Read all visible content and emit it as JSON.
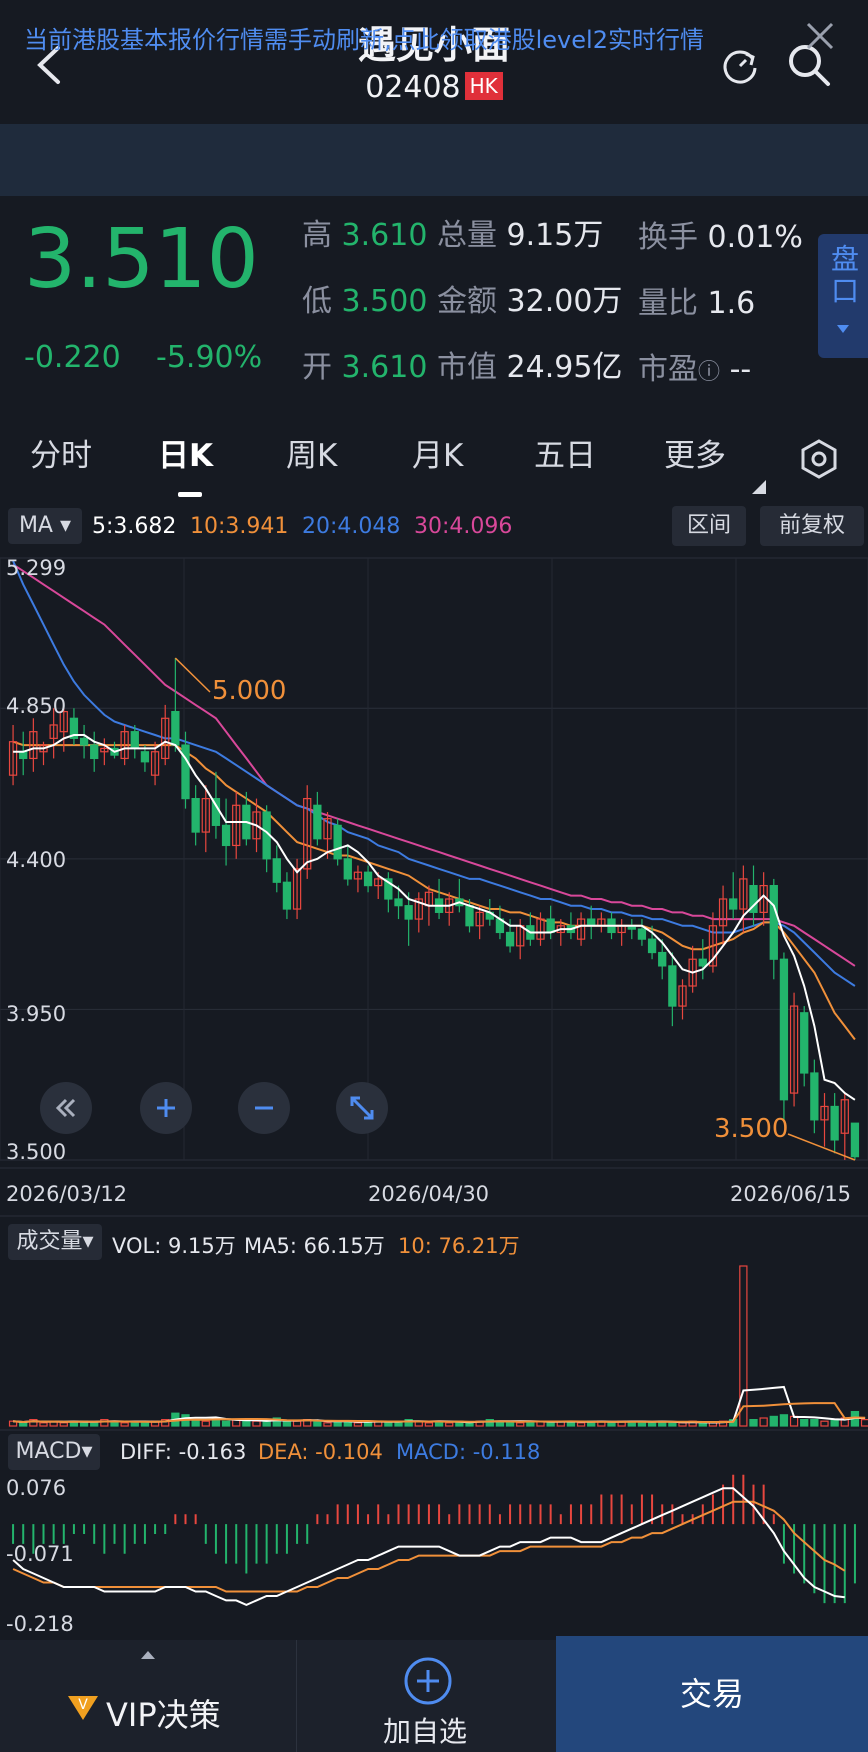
{
  "header": {
    "title": "遇见小面",
    "code": "02408",
    "market_badge": "HK",
    "icons": [
      "back-arrow-icon",
      "refresh-icon",
      "search-icon"
    ]
  },
  "notice": {
    "text": "当前港股基本报价行情需手动刷新,点此领取港股level2实时行情",
    "close_icon": "close-icon"
  },
  "quote": {
    "price": "3.510",
    "change": "-0.220",
    "change_pct": "-5.90%",
    "high_label": "高",
    "high": "3.610",
    "low_label": "低",
    "low": "3.500",
    "open_label": "开",
    "open": "3.610",
    "volume_label": "总量",
    "volume": "9.15万",
    "turnover_label": "金额",
    "turnover": "32.00万",
    "mktcap_label": "市值",
    "mktcap": "24.95亿",
    "turnover_rate_label": "换手",
    "turnover_rate": "0.01%",
    "vol_ratio_label": "量比",
    "vol_ratio": "1.6",
    "pe_label": "市盈",
    "pe": "--",
    "panel_label": "盘口"
  },
  "tabs": [
    "分时",
    "日K",
    "周K",
    "月K",
    "五日",
    "更多"
  ],
  "active_tab": "日K",
  "ma_legend": {
    "toggle": "MA",
    "ma5": "5:3.682",
    "ma10": "10:3.941",
    "ma20": "20:4.048",
    "ma30": "30:4.096",
    "range_btn": "区间",
    "adjust_btn": "前复权"
  },
  "colors": {
    "up": "#e8473f",
    "down": "#23b46c",
    "ma5": "#ffffff",
    "ma10": "#f0903a",
    "ma20": "#3d7be0",
    "ma30": "#d8489a",
    "accent": "#4f8cf0"
  },
  "chart_data": {
    "type": "candlestick",
    "y_ticks": [
      "5.299",
      "4.850",
      "4.400",
      "3.950",
      "3.500"
    ],
    "ylim": [
      3.5,
      5.299
    ],
    "x_ticks": [
      "2026/03/12",
      "2026/04/30",
      "2026/06/15"
    ],
    "annotations": {
      "max": "5.000",
      "min": "3.500"
    },
    "candles": [
      {
        "o": 4.65,
        "h": 4.8,
        "l": 4.62,
        "c": 4.75
      },
      {
        "o": 4.72,
        "h": 4.78,
        "l": 4.65,
        "c": 4.7
      },
      {
        "o": 4.7,
        "h": 4.82,
        "l": 4.66,
        "c": 4.78
      },
      {
        "o": 4.72,
        "h": 4.75,
        "l": 4.68,
        "c": 4.74
      },
      {
        "o": 4.76,
        "h": 4.85,
        "l": 4.7,
        "c": 4.8
      },
      {
        "o": 4.78,
        "h": 4.86,
        "l": 4.72,
        "c": 4.84
      },
      {
        "o": 4.82,
        "h": 4.85,
        "l": 4.74,
        "c": 4.76
      },
      {
        "o": 4.76,
        "h": 4.8,
        "l": 4.7,
        "c": 4.74
      },
      {
        "o": 4.74,
        "h": 4.78,
        "l": 4.66,
        "c": 4.7
      },
      {
        "o": 4.72,
        "h": 4.76,
        "l": 4.68,
        "c": 4.73
      },
      {
        "o": 4.73,
        "h": 4.75,
        "l": 4.7,
        "c": 4.71
      },
      {
        "o": 4.7,
        "h": 4.8,
        "l": 4.68,
        "c": 4.78
      },
      {
        "o": 4.78,
        "h": 4.8,
        "l": 4.7,
        "c": 4.73
      },
      {
        "o": 4.72,
        "h": 4.74,
        "l": 4.66,
        "c": 4.69
      },
      {
        "o": 4.65,
        "h": 4.75,
        "l": 4.62,
        "c": 4.72
      },
      {
        "o": 4.7,
        "h": 4.86,
        "l": 4.68,
        "c": 4.82
      },
      {
        "o": 4.84,
        "h": 5.0,
        "l": 4.72,
        "c": 4.74
      },
      {
        "o": 4.74,
        "h": 4.78,
        "l": 4.55,
        "c": 4.58
      },
      {
        "o": 4.58,
        "h": 4.62,
        "l": 4.44,
        "c": 4.48
      },
      {
        "o": 4.48,
        "h": 4.62,
        "l": 4.42,
        "c": 4.58
      },
      {
        "o": 4.58,
        "h": 4.66,
        "l": 4.46,
        "c": 4.5
      },
      {
        "o": 4.5,
        "h": 4.58,
        "l": 4.38,
        "c": 4.44
      },
      {
        "o": 4.44,
        "h": 4.6,
        "l": 4.4,
        "c": 4.56
      },
      {
        "o": 4.56,
        "h": 4.6,
        "l": 4.44,
        "c": 4.46
      },
      {
        "o": 4.46,
        "h": 4.58,
        "l": 4.42,
        "c": 4.54
      },
      {
        "o": 4.54,
        "h": 4.56,
        "l": 4.36,
        "c": 4.4
      },
      {
        "o": 4.4,
        "h": 4.44,
        "l": 4.3,
        "c": 4.33
      },
      {
        "o": 4.33,
        "h": 4.36,
        "l": 4.22,
        "c": 4.25
      },
      {
        "o": 4.25,
        "h": 4.4,
        "l": 4.22,
        "c": 4.37
      },
      {
        "o": 4.37,
        "h": 4.62,
        "l": 4.34,
        "c": 4.58
      },
      {
        "o": 4.56,
        "h": 4.6,
        "l": 4.44,
        "c": 4.46
      },
      {
        "o": 4.46,
        "h": 4.54,
        "l": 4.4,
        "c": 4.52
      },
      {
        "o": 4.5,
        "h": 4.52,
        "l": 4.38,
        "c": 4.4
      },
      {
        "o": 4.4,
        "h": 4.44,
        "l": 4.32,
        "c": 4.34
      },
      {
        "o": 4.34,
        "h": 4.38,
        "l": 4.3,
        "c": 4.36
      },
      {
        "o": 4.36,
        "h": 4.38,
        "l": 4.3,
        "c": 4.32
      },
      {
        "o": 4.32,
        "h": 4.36,
        "l": 4.28,
        "c": 4.34
      },
      {
        "o": 4.34,
        "h": 4.36,
        "l": 4.24,
        "c": 4.28
      },
      {
        "o": 4.28,
        "h": 4.32,
        "l": 4.22,
        "c": 4.26
      },
      {
        "o": 4.26,
        "h": 4.3,
        "l": 4.14,
        "c": 4.22
      },
      {
        "o": 4.22,
        "h": 4.3,
        "l": 4.18,
        "c": 4.28
      },
      {
        "o": 4.26,
        "h": 4.32,
        "l": 4.2,
        "c": 4.3
      },
      {
        "o": 4.28,
        "h": 4.34,
        "l": 4.22,
        "c": 4.24
      },
      {
        "o": 4.24,
        "h": 4.3,
        "l": 4.2,
        "c": 4.28
      },
      {
        "o": 4.28,
        "h": 4.34,
        "l": 4.24,
        "c": 4.26
      },
      {
        "o": 4.26,
        "h": 4.28,
        "l": 4.18,
        "c": 4.2
      },
      {
        "o": 4.2,
        "h": 4.26,
        "l": 4.16,
        "c": 4.24
      },
      {
        "o": 4.24,
        "h": 4.28,
        "l": 4.2,
        "c": 4.22
      },
      {
        "o": 4.22,
        "h": 4.26,
        "l": 4.16,
        "c": 4.18
      },
      {
        "o": 4.18,
        "h": 4.22,
        "l": 4.12,
        "c": 4.14
      },
      {
        "o": 4.14,
        "h": 4.22,
        "l": 4.1,
        "c": 4.2
      },
      {
        "o": 4.2,
        "h": 4.24,
        "l": 4.14,
        "c": 4.16
      },
      {
        "o": 4.16,
        "h": 4.24,
        "l": 4.14,
        "c": 4.22
      },
      {
        "o": 4.22,
        "h": 4.26,
        "l": 4.16,
        "c": 4.18
      },
      {
        "o": 4.18,
        "h": 4.22,
        "l": 4.14,
        "c": 4.2
      },
      {
        "o": 4.2,
        "h": 4.24,
        "l": 4.16,
        "c": 4.18
      },
      {
        "o": 4.16,
        "h": 4.24,
        "l": 4.14,
        "c": 4.22
      },
      {
        "o": 4.22,
        "h": 4.26,
        "l": 4.16,
        "c": 4.2
      },
      {
        "o": 4.2,
        "h": 4.24,
        "l": 4.18,
        "c": 4.22
      },
      {
        "o": 4.22,
        "h": 4.24,
        "l": 4.16,
        "c": 4.18
      },
      {
        "o": 4.18,
        "h": 4.22,
        "l": 4.14,
        "c": 4.2
      },
      {
        "o": 4.2,
        "h": 4.22,
        "l": 4.16,
        "c": 4.19
      },
      {
        "o": 4.19,
        "h": 4.22,
        "l": 4.14,
        "c": 4.16
      },
      {
        "o": 4.16,
        "h": 4.2,
        "l": 4.1,
        "c": 4.12
      },
      {
        "o": 4.12,
        "h": 4.16,
        "l": 4.04,
        "c": 4.08
      },
      {
        "o": 4.08,
        "h": 4.12,
        "l": 3.9,
        "c": 3.96
      },
      {
        "o": 3.96,
        "h": 4.04,
        "l": 3.92,
        "c": 4.02
      },
      {
        "o": 4.02,
        "h": 4.14,
        "l": 4.0,
        "c": 4.1
      },
      {
        "o": 4.1,
        "h": 4.16,
        "l": 4.04,
        "c": 4.08
      },
      {
        "o": 4.08,
        "h": 4.24,
        "l": 4.06,
        "c": 4.2
      },
      {
        "o": 4.2,
        "h": 4.32,
        "l": 4.14,
        "c": 4.28
      },
      {
        "o": 4.28,
        "h": 4.36,
        "l": 4.22,
        "c": 4.25
      },
      {
        "o": 4.25,
        "h": 4.38,
        "l": 4.18,
        "c": 4.34
      },
      {
        "o": 4.32,
        "h": 4.38,
        "l": 4.2,
        "c": 4.24
      },
      {
        "o": 4.24,
        "h": 4.36,
        "l": 4.2,
        "c": 4.32
      },
      {
        "o": 4.32,
        "h": 4.34,
        "l": 4.04,
        "c": 4.1
      },
      {
        "o": 4.1,
        "h": 4.12,
        "l": 3.62,
        "c": 3.68
      },
      {
        "o": 3.7,
        "h": 4.0,
        "l": 3.66,
        "c": 3.96
      },
      {
        "o": 3.94,
        "h": 3.96,
        "l": 3.72,
        "c": 3.76
      },
      {
        "o": 3.76,
        "h": 3.8,
        "l": 3.58,
        "c": 3.62
      },
      {
        "o": 3.62,
        "h": 3.7,
        "l": 3.54,
        "c": 3.66
      },
      {
        "o": 3.66,
        "h": 3.7,
        "l": 3.52,
        "c": 3.56
      },
      {
        "o": 3.58,
        "h": 3.7,
        "l": 3.5,
        "c": 3.68
      },
      {
        "o": 3.61,
        "h": 3.61,
        "l": 3.5,
        "c": 3.51
      }
    ],
    "ma5_line": [
      4.72,
      4.72,
      4.73,
      4.73,
      4.74,
      4.76,
      4.77,
      4.77,
      4.75,
      4.74,
      4.72,
      4.73,
      4.73,
      4.73,
      4.73,
      4.75,
      4.74,
      4.7,
      4.65,
      4.61,
      4.56,
      4.51,
      4.51,
      4.51,
      4.5,
      4.48,
      4.45,
      4.4,
      4.36,
      4.39,
      4.4,
      4.42,
      4.43,
      4.44,
      4.42,
      4.39,
      4.35,
      4.33,
      4.31,
      4.28,
      4.27,
      4.26,
      4.26,
      4.26,
      4.27,
      4.26,
      4.25,
      4.24,
      4.22,
      4.2,
      4.2,
      4.18,
      4.18,
      4.18,
      4.19,
      4.19,
      4.2,
      4.2,
      4.2,
      4.2,
      4.2,
      4.2,
      4.2,
      4.18,
      4.15,
      4.11,
      4.07,
      4.06,
      4.07,
      4.1,
      4.14,
      4.18,
      4.23,
      4.26,
      4.29,
      4.26,
      4.17,
      4.11,
      4.02,
      3.9,
      3.74,
      3.73,
      3.7,
      3.68
    ],
    "ma10_line": [
      4.75,
      4.74,
      4.74,
      4.74,
      4.74,
      4.74,
      4.74,
      4.74,
      4.74,
      4.74,
      4.74,
      4.74,
      4.74,
      4.74,
      4.74,
      4.74,
      4.74,
      4.72,
      4.7,
      4.67,
      4.65,
      4.62,
      4.6,
      4.58,
      4.56,
      4.54,
      4.51,
      4.48,
      4.45,
      4.44,
      4.43,
      4.42,
      4.41,
      4.41,
      4.4,
      4.39,
      4.38,
      4.37,
      4.36,
      4.35,
      4.33,
      4.31,
      4.3,
      4.29,
      4.28,
      4.27,
      4.26,
      4.25,
      4.25,
      4.24,
      4.24,
      4.23,
      4.22,
      4.21,
      4.21,
      4.2,
      4.2,
      4.2,
      4.2,
      4.2,
      4.2,
      4.2,
      4.2,
      4.19,
      4.18,
      4.16,
      4.14,
      4.13,
      4.13,
      4.14,
      4.15,
      4.16,
      4.18,
      4.19,
      4.21,
      4.21,
      4.18,
      4.14,
      4.1,
      4.06,
      4.0,
      3.94,
      3.9,
      3.86
    ],
    "ma20_line": [
      5.29,
      5.22,
      5.16,
      5.1,
      5.04,
      4.98,
      4.93,
      4.89,
      4.86,
      4.83,
      4.81,
      4.8,
      4.79,
      4.78,
      4.77,
      4.76,
      4.76,
      4.75,
      4.74,
      4.73,
      4.72,
      4.7,
      4.68,
      4.66,
      4.64,
      4.62,
      4.6,
      4.58,
      4.56,
      4.55,
      4.53,
      4.51,
      4.5,
      4.48,
      4.47,
      4.46,
      4.44,
      4.43,
      4.42,
      4.4,
      4.39,
      4.38,
      4.37,
      4.36,
      4.35,
      4.34,
      4.34,
      4.33,
      4.32,
      4.31,
      4.3,
      4.29,
      4.28,
      4.28,
      4.27,
      4.26,
      4.26,
      4.25,
      4.25,
      4.24,
      4.24,
      4.23,
      4.23,
      4.22,
      4.22,
      4.21,
      4.2,
      4.2,
      4.19,
      4.18,
      4.18,
      4.18,
      4.19,
      4.2,
      4.21,
      4.21,
      4.2,
      4.18,
      4.15,
      4.12,
      4.09,
      4.06,
      4.04,
      4.02
    ],
    "ma30_line": [
      5.28,
      5.26,
      5.24,
      5.22,
      5.2,
      5.18,
      5.16,
      5.14,
      5.12,
      5.1,
      5.07,
      5.04,
      5.01,
      4.98,
      4.95,
      4.92,
      4.9,
      4.88,
      4.86,
      4.84,
      4.82,
      4.78,
      4.74,
      4.7,
      4.66,
      4.62,
      4.6,
      4.58,
      4.56,
      4.55,
      4.54,
      4.53,
      4.52,
      4.51,
      4.5,
      4.49,
      4.48,
      4.47,
      4.46,
      4.45,
      4.44,
      4.43,
      4.42,
      4.41,
      4.4,
      4.39,
      4.38,
      4.37,
      4.36,
      4.35,
      4.34,
      4.33,
      4.32,
      4.31,
      4.3,
      4.29,
      4.29,
      4.28,
      4.28,
      4.27,
      4.27,
      4.26,
      4.26,
      4.25,
      4.25,
      4.24,
      4.24,
      4.23,
      4.23,
      4.22,
      4.22,
      4.22,
      4.22,
      4.22,
      4.22,
      4.22,
      4.21,
      4.2,
      4.18,
      4.16,
      4.14,
      4.12,
      4.1,
      4.08
    ],
    "volume": {
      "toggle": "成交量",
      "vol": "VOL: 9.15万",
      "ma5": "MA5: 66.15万",
      "ma10": "10: 76.21万",
      "bars": [
        3,
        2,
        4,
        2,
        3,
        2,
        3,
        3,
        2,
        4,
        3,
        2,
        3,
        2,
        3,
        4,
        8,
        7,
        4,
        3,
        5,
        3,
        4,
        3,
        3,
        3,
        5,
        3,
        3,
        4,
        3,
        2,
        3,
        3,
        2,
        3,
        3,
        2,
        3,
        4,
        3,
        2,
        3,
        2,
        3,
        2,
        3,
        4,
        3,
        3,
        2,
        3,
        3,
        2,
        3,
        3,
        2,
        3,
        3,
        2,
        3,
        3,
        3,
        2,
        3,
        2,
        2,
        3,
        2,
        2,
        3,
        4,
        100,
        4,
        5,
        6,
        7,
        6,
        4,
        4,
        3,
        4,
        5,
        9,
        4
      ]
    },
    "macd": {
      "toggle": "MACD",
      "diff": "DIFF: -0.163",
      "dea": "DEA: -0.104",
      "macd": "MACD: -0.118",
      "y_ticks": [
        "0.076",
        "-0.071",
        "-0.218"
      ],
      "hist": [
        -0.02,
        -0.02,
        -0.03,
        -0.02,
        -0.02,
        -0.02,
        -0.01,
        -0.01,
        -0.02,
        -0.03,
        -0.02,
        -0.03,
        -0.02,
        -0.02,
        -0.01,
        -0.01,
        0.01,
        0.01,
        0.01,
        -0.02,
        -0.03,
        -0.04,
        -0.04,
        -0.05,
        -0.04,
        -0.04,
        -0.03,
        -0.03,
        -0.02,
        -0.02,
        0.01,
        0.01,
        0.02,
        0.02,
        0.02,
        0.01,
        0.02,
        0.01,
        0.02,
        0.02,
        0.02,
        0.02,
        0.02,
        0.01,
        0.02,
        0.02,
        0.02,
        0.02,
        0.01,
        0.02,
        0.02,
        0.02,
        0.02,
        0.02,
        0.01,
        0.02,
        0.02,
        0.02,
        0.03,
        0.03,
        0.03,
        0.02,
        0.03,
        0.03,
        0.02,
        0.02,
        0.01,
        0.01,
        0.02,
        0.03,
        0.04,
        0.05,
        0.05,
        0.04,
        0.04,
        0.01,
        -0.04,
        -0.05,
        -0.06,
        -0.07,
        -0.08,
        -0.08,
        -0.08,
        -0.06
      ],
      "diff_line": [
        -0.08,
        -0.1,
        -0.11,
        -0.12,
        -0.13,
        -0.14,
        -0.14,
        -0.14,
        -0.14,
        -0.15,
        -0.15,
        -0.15,
        -0.15,
        -0.15,
        -0.15,
        -0.14,
        -0.14,
        -0.14,
        -0.15,
        -0.15,
        -0.16,
        -0.17,
        -0.17,
        -0.18,
        -0.17,
        -0.16,
        -0.16,
        -0.15,
        -0.14,
        -0.13,
        -0.12,
        -0.11,
        -0.1,
        -0.09,
        -0.08,
        -0.08,
        -0.07,
        -0.06,
        -0.05,
        -0.05,
        -0.05,
        -0.05,
        -0.05,
        -0.06,
        -0.07,
        -0.07,
        -0.07,
        -0.06,
        -0.05,
        -0.05,
        -0.04,
        -0.04,
        -0.04,
        -0.03,
        -0.03,
        -0.03,
        -0.04,
        -0.04,
        -0.04,
        -0.03,
        -0.02,
        -0.01,
        0.0,
        0.01,
        0.02,
        0.03,
        0.04,
        0.05,
        0.06,
        0.07,
        0.08,
        0.08,
        0.06,
        0.04,
        0.01,
        -0.02,
        -0.06,
        -0.09,
        -0.12,
        -0.14,
        -0.15,
        -0.16,
        -0.163
      ],
      "dea_line": [
        -0.1,
        -0.11,
        -0.12,
        -0.13,
        -0.13,
        -0.14,
        -0.14,
        -0.14,
        -0.14,
        -0.14,
        -0.14,
        -0.14,
        -0.14,
        -0.14,
        -0.14,
        -0.14,
        -0.14,
        -0.14,
        -0.14,
        -0.14,
        -0.14,
        -0.15,
        -0.15,
        -0.15,
        -0.15,
        -0.15,
        -0.15,
        -0.15,
        -0.15,
        -0.14,
        -0.14,
        -0.13,
        -0.12,
        -0.12,
        -0.11,
        -0.1,
        -0.1,
        -0.09,
        -0.08,
        -0.08,
        -0.07,
        -0.07,
        -0.07,
        -0.07,
        -0.07,
        -0.07,
        -0.07,
        -0.07,
        -0.06,
        -0.06,
        -0.06,
        -0.05,
        -0.05,
        -0.05,
        -0.05,
        -0.05,
        -0.05,
        -0.05,
        -0.05,
        -0.04,
        -0.04,
        -0.03,
        -0.03,
        -0.02,
        -0.02,
        -0.01,
        0.0,
        0.01,
        0.02,
        0.03,
        0.04,
        0.05,
        0.05,
        0.05,
        0.04,
        0.03,
        0.01,
        -0.02,
        -0.04,
        -0.06,
        -0.08,
        -0.09,
        -0.104
      ]
    }
  },
  "bottom_bar": {
    "vip_label": "VIP决策",
    "watch_label": "加自选",
    "trade_label": "交易"
  }
}
